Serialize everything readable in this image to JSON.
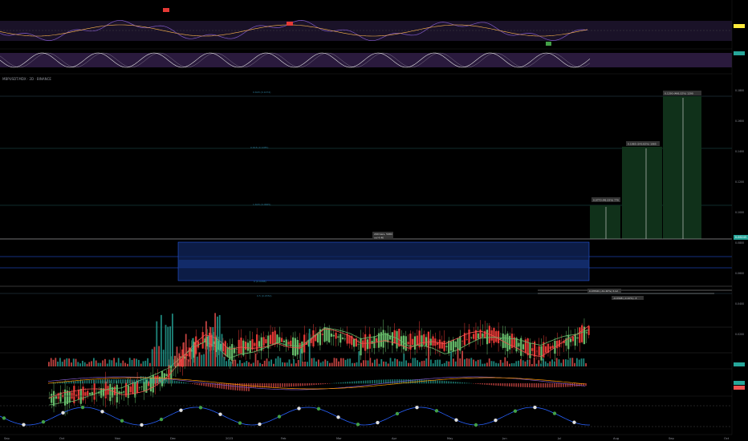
{
  "symbol": "MBPUSDT.MDX · 2D · BINANCE",
  "current_price": "0.06245",
  "x_labels": [
    "Sep",
    "Oct",
    "Nov",
    "Dec",
    "2023",
    "Feb",
    "Mar",
    "Apr",
    "May",
    "Jun",
    "Jul",
    "Aug",
    "Sep",
    "Oct"
  ],
  "price_axis_labels": [
    "0.1800",
    "0.1600",
    "0.1400",
    "0.1200",
    "0.1000",
    "0.0800",
    "0.0600",
    "0.0400",
    "0.0200"
  ],
  "targets": [
    {
      "label": "0.0770 (46.33%) 770"
    },
    {
      "label": "0.1065 (143.82%) 1065"
    },
    {
      "label": "0.1290 (466.32%) 1290"
    }
  ],
  "fib_labels": [
    "0.618 (0.1474)",
    "0.618 (0.1085)",
    "1.618 (0.0665)",
    "0 (0.0488)",
    "0.5 (0.0352)"
  ],
  "box_label": "299 bars, 598d",
  "box_sub": "vol 4.4K",
  "stop_labels": [
    "0.03500 (-41.40%) 3.12",
    "-0.0348 (-4.10%) -3"
  ],
  "colors": {
    "up": "#26a69a",
    "down": "#ef5350",
    "bull": "#66bb6a",
    "bear": "#e53935",
    "range_box": "#1e3a8a",
    "target_fill": "#0f2a14",
    "rsi_band": "#2a1a3d"
  },
  "chart_data": {
    "type": "candlestick",
    "panes": [
      "RSI",
      "Stochastic RSI",
      "Price",
      "Volume",
      "MACD",
      "Oscillator"
    ],
    "price": {
      "ylim": [
        0.02,
        0.18
      ],
      "closes": [
        0.024,
        0.025,
        0.025,
        0.026,
        0.027,
        0.028,
        0.027,
        0.029,
        0.031,
        0.034,
        0.038,
        0.045,
        0.052,
        0.057,
        0.055,
        0.05,
        0.053,
        0.054,
        0.056,
        0.058,
        0.055,
        0.053,
        0.057,
        0.061,
        0.059,
        0.057,
        0.054,
        0.056,
        0.059,
        0.058,
        0.055,
        0.057,
        0.056,
        0.053,
        0.055,
        0.058,
        0.06,
        0.059,
        0.057,
        0.055,
        0.052,
        0.05,
        0.053,
        0.056,
        0.058,
        0.062
      ],
      "range_box": {
        "high": 0.062,
        "low": 0.049
      },
      "targets": [
        0.077,
        0.1065,
        0.129
      ]
    }
  }
}
